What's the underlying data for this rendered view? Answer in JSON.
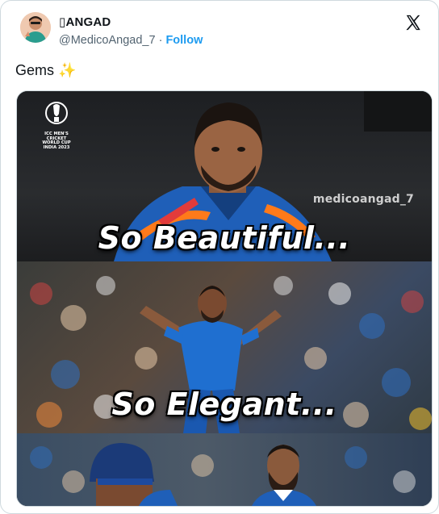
{
  "author": {
    "display_name": "▯ANGAD",
    "handle": "@MedicoAngad_7",
    "separator": "·",
    "follow_label": "Follow"
  },
  "tweet": {
    "text": "Gems",
    "emoji": "✨"
  },
  "media": {
    "panels": [
      {
        "caption": "So Beautiful...",
        "watermark": "medicoangad_7",
        "logo_text": [
          "ICC MEN'S",
          "CRICKET",
          "WORLD CUP",
          "INDIA 2023"
        ]
      },
      {
        "caption": "So Elegant..."
      },
      {
        "caption": ""
      }
    ]
  },
  "icons": {
    "platform_logo": "x-logo-icon",
    "sparkle": "sparkles-icon"
  },
  "colors": {
    "follow_blue": "#1d9bf0",
    "secondary_text": "#536471",
    "border": "#cfd9de",
    "jersey_blue": "#1f5fb8"
  }
}
